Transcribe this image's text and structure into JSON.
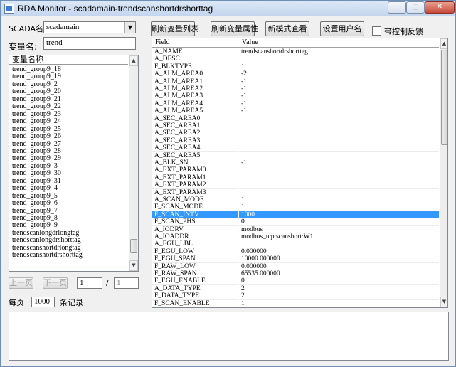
{
  "window": {
    "title": "RDA Monitor - scadamain-trendscanshortdrshorttag"
  },
  "scada": {
    "label": "SCADA名称",
    "selected": "scadamain"
  },
  "variable": {
    "label": "变量名:",
    "value": "trend"
  },
  "toolbar": {
    "refresh_list": "刷新变量列表",
    "refresh_attr": "刷新变量属性",
    "new_mode": "新模式查看",
    "set_user": "设置用户名",
    "feedback_label": "带控制反馈"
  },
  "list": {
    "header": "变量名称",
    "items": [
      "trend_group9_18",
      "trend_group9_19",
      "trend_group9_2",
      "trend_group9_20",
      "trend_group9_21",
      "trend_group9_22",
      "trend_group9_23",
      "trend_group9_24",
      "trend_group9_25",
      "trend_group9_26",
      "trend_group9_27",
      "trend_group9_28",
      "trend_group9_29",
      "trend_group9_3",
      "trend_group9_30",
      "trend_group9_31",
      "trend_group9_4",
      "trend_group9_5",
      "trend_group9_6",
      "trend_group9_7",
      "trend_group9_8",
      "trend_group9_9",
      "trendscanlongdrlongtag",
      "trendscanlongdrshorttag",
      "trendscanshortdrlongtag",
      "trendscanshortdrshorttag"
    ]
  },
  "pager": {
    "prev": "上一页",
    "next": "下一页",
    "current": "1",
    "separator": "/",
    "total": "1",
    "per_page_label": "每页",
    "per_page": "1000",
    "records_label": "条记录"
  },
  "grid": {
    "col_field": "Field",
    "col_value": "Value",
    "rows": [
      [
        "A_NAME",
        "trendscanshortdrshorttag"
      ],
      [
        "A_DESC",
        ""
      ],
      [
        "F_BLKTYPE",
        "1"
      ],
      [
        "A_ALM_AREA0",
        "-2"
      ],
      [
        "A_ALM_AREA1",
        "-1"
      ],
      [
        "A_ALM_AREA2",
        "-1"
      ],
      [
        "A_ALM_AREA3",
        "-1"
      ],
      [
        "A_ALM_AREA4",
        "-1"
      ],
      [
        "A_ALM_AREA5",
        "-1"
      ],
      [
        "A_SEC_AREA0",
        ""
      ],
      [
        "A_SEC_AREA1",
        ""
      ],
      [
        "A_SEC_AREA2",
        ""
      ],
      [
        "A_SEC_AREA3",
        ""
      ],
      [
        "A_SEC_AREA4",
        ""
      ],
      [
        "A_SEC_AREA5",
        ""
      ],
      [
        "A_BLK_SN",
        "-1"
      ],
      [
        "A_EXT_PARAM0",
        ""
      ],
      [
        "A_EXT_PARAM1",
        ""
      ],
      [
        "A_EXT_PARAM2",
        ""
      ],
      [
        "A_EXT_PARAM3",
        ""
      ],
      [
        "A_SCAN_MODE",
        "1"
      ],
      [
        "F_SCAN_MODE",
        "1"
      ],
      [
        "F_SCAN_INTV",
        "1000"
      ],
      [
        "F_SCAN_PHS",
        "0"
      ],
      [
        "A_IODRV",
        "modbus"
      ],
      [
        "A_IOADDR",
        "modbus_tcp:scanshort:W1"
      ],
      [
        "A_EGU_LBL",
        ""
      ],
      [
        "F_EGU_LOW",
        "0.000000"
      ],
      [
        "F_EGU_SPAN",
        "10000.000000"
      ],
      [
        "F_RAW_LOW",
        "0.000000"
      ],
      [
        "F_RAW_SPAN",
        "65535.000000"
      ],
      [
        "F_EGU_ENABLE",
        "0"
      ],
      [
        "A_DATA_TYPE",
        "2"
      ],
      [
        "F_DATA_TYPE",
        "2"
      ],
      [
        "F_SCAN_ENABLE",
        "1"
      ]
    ],
    "selected_index": 22
  },
  "log": {
    "text": ""
  }
}
